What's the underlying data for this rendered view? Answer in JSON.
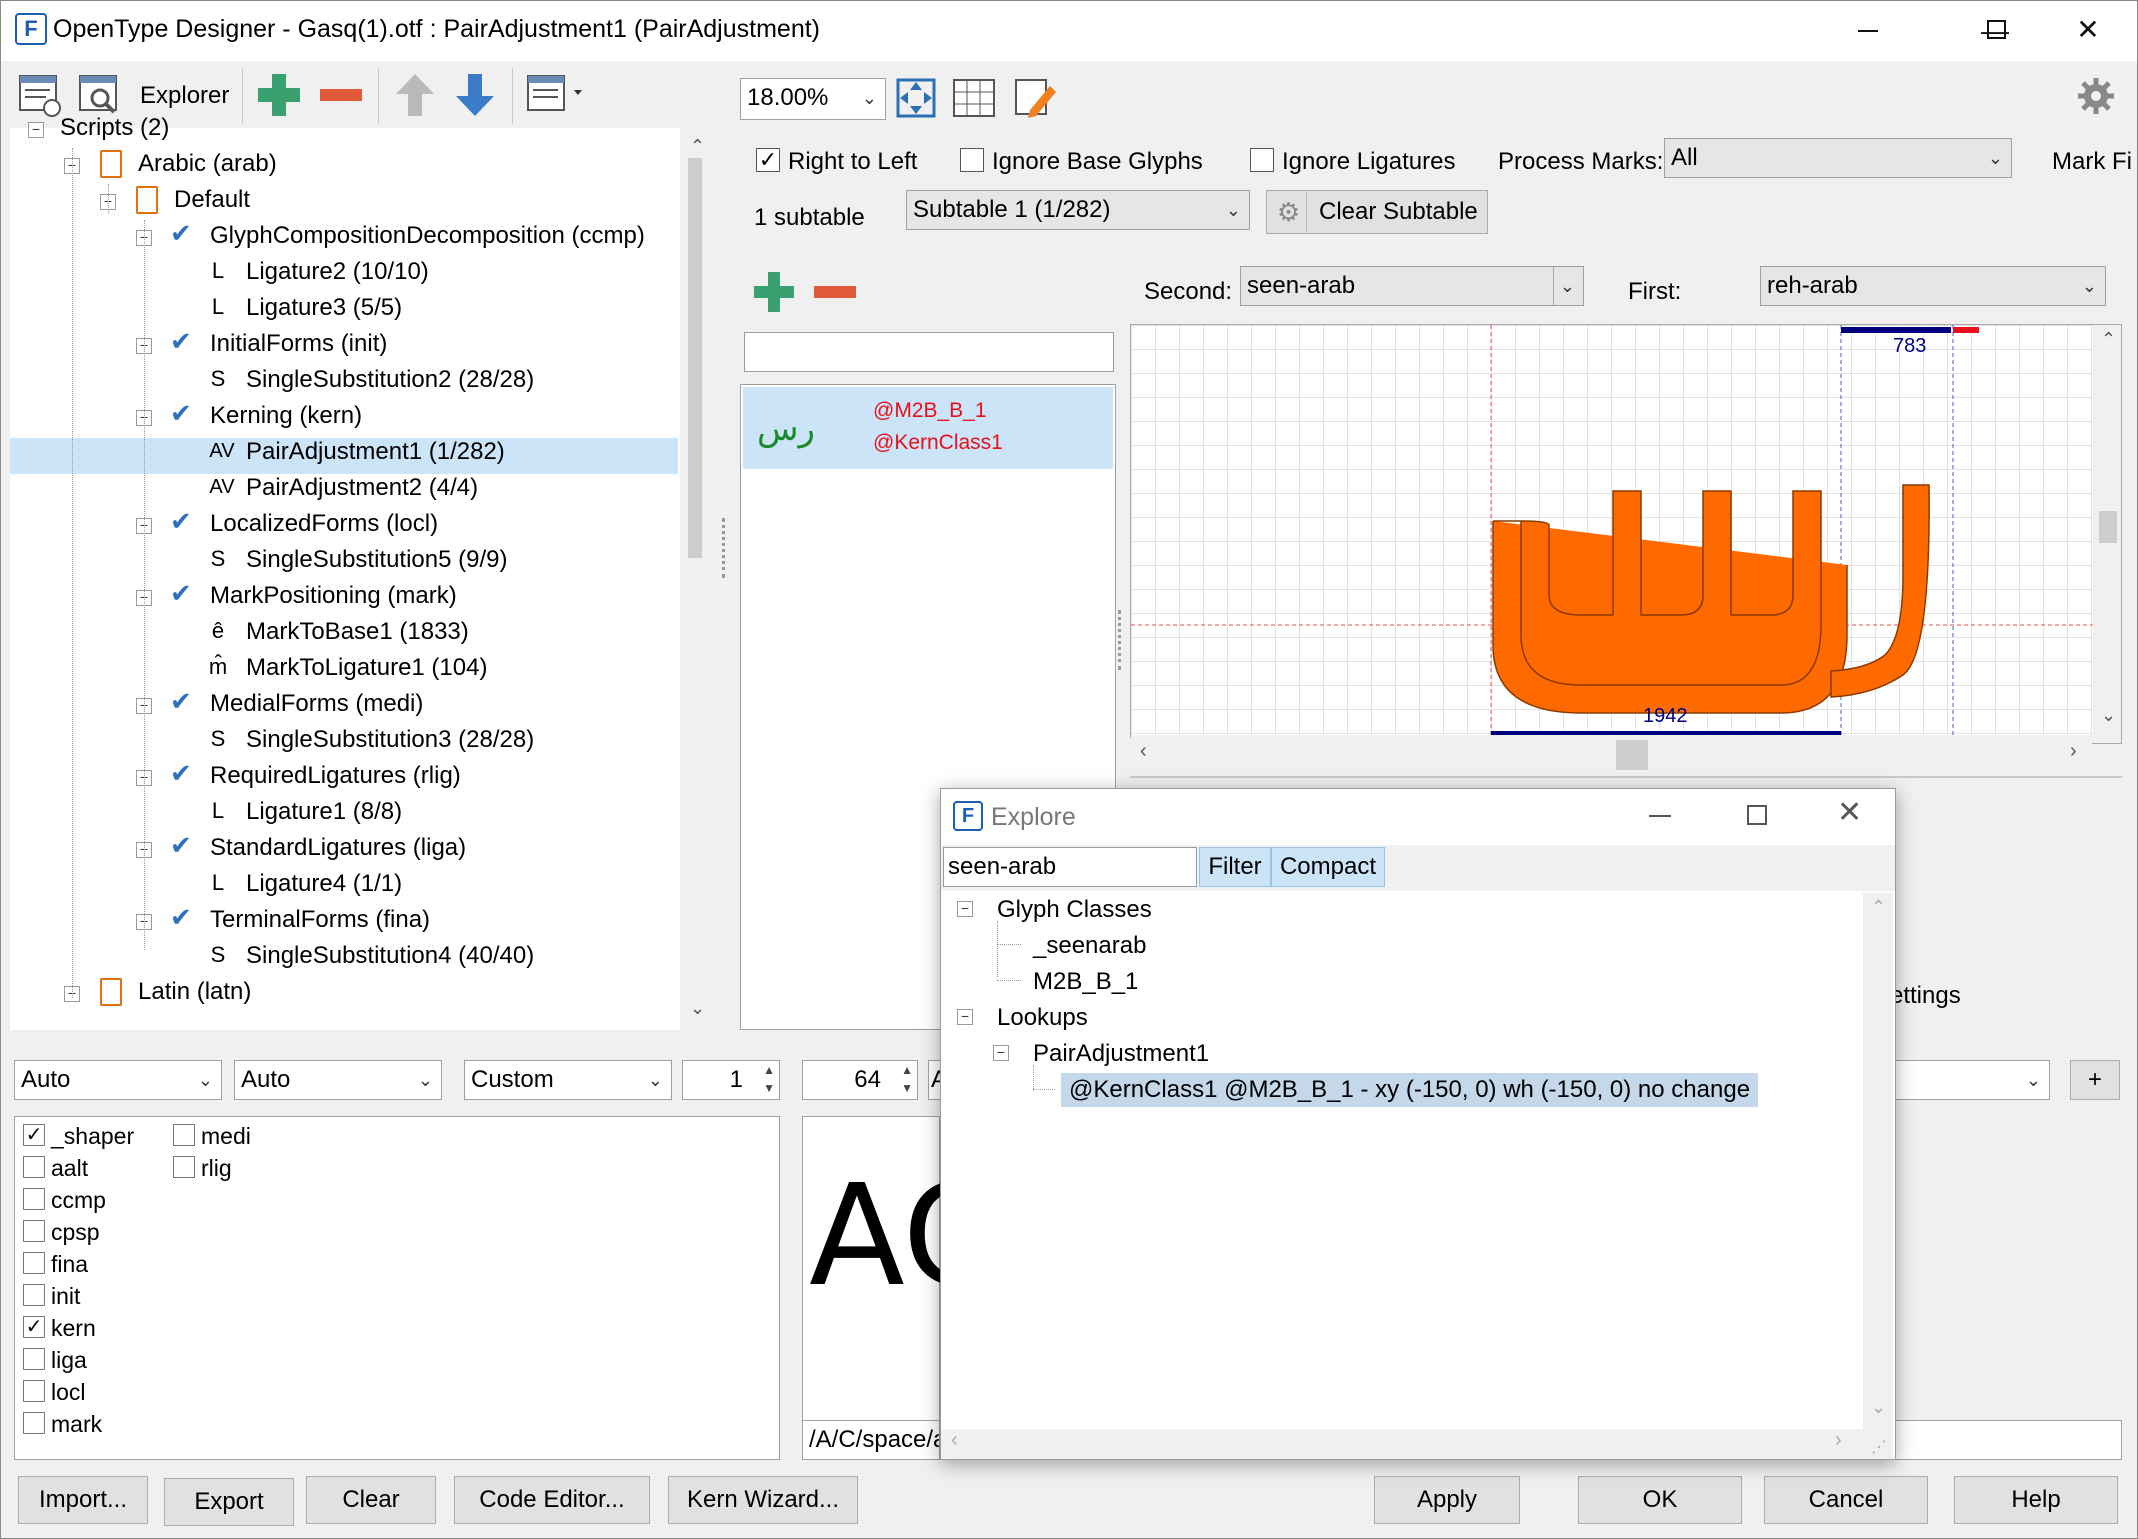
{
  "window": {
    "title": "OpenType Designer - Gasq(1).otf : PairAdjustment1 (PairAdjustment)",
    "app_icon": "F",
    "minimize": "—",
    "maximize": "☐",
    "close": "✕"
  },
  "toolbar": {
    "explorer_label": "Explorer",
    "zoom_value": "18.00%"
  },
  "tree": {
    "root": "Scripts (2)",
    "arabic": "Arabic (arab)",
    "default": "Default",
    "ccmp": "GlyphCompositionDecomposition (ccmp)",
    "lig2": "Ligature2 (10/10)",
    "lig3": "Ligature3 (5/5)",
    "init": "InitialForms (init)",
    "ss2": "SingleSubstitution2 (28/28)",
    "kern": "Kerning (kern)",
    "pa1": "PairAdjustment1 (1/282)",
    "pa2": "PairAdjustment2 (4/4)",
    "locl": "LocalizedForms (locl)",
    "ss5": "SingleSubstitution5 (9/9)",
    "mark": "MarkPositioning (mark)",
    "mtb": "MarkToBase1 (1833)",
    "mtl": "MarkToLigature1 (104)",
    "medi": "MedialForms (medi)",
    "ss3": "SingleSubstitution3 (28/28)",
    "rlig": "RequiredLigatures (rlig)",
    "lig1": "Ligature1 (8/8)",
    "liga": "StandardLigatures (liga)",
    "lig4": "Ligature4 (1/1)",
    "fina": "TerminalForms (fina)",
    "ss4": "SingleSubstitution4 (40/40)",
    "latin": "Latin (latn)",
    "icons": {
      "L": "L",
      "S": "S",
      "AV": "AV",
      "mtb": "ê",
      "mtl": "m̂"
    }
  },
  "options": {
    "rtl": "Right to Left",
    "ignore_base": "Ignore Base Glyphs",
    "ignore_lig": "Ignore Ligatures",
    "process_marks": "Process Marks:",
    "process_marks_value": "All",
    "mark_filter": "Mark Fi",
    "subtable_count": "1 subtable",
    "subtable_value": "Subtable 1 (1/282)",
    "clear_subtable": "Clear Subtable"
  },
  "pair": {
    "second_label": "Second:",
    "second_value": "seen-arab",
    "first_label": "First:",
    "first_value": "reh-arab",
    "list_glyph": "رس",
    "list_class1": "@M2B_B_1",
    "list_class2": "@KernClass1",
    "measure_top": "783",
    "measure_bottom": "1942",
    "settings_partial": "ettings"
  },
  "bottom": {
    "combo1": "Auto",
    "combo2": "Auto",
    "combo3": "Custom",
    "spin1": "1",
    "spin2": "64",
    "spin3_partial": "A",
    "preview_text": "AC",
    "preview_input": "/A/C/space/a",
    "plus": "+",
    "features": [
      {
        "name": "_shaper",
        "checked": true
      },
      {
        "name": "aalt",
        "checked": false
      },
      {
        "name": "ccmp",
        "checked": false
      },
      {
        "name": "cpsp",
        "checked": false
      },
      {
        "name": "fina",
        "checked": false
      },
      {
        "name": "init",
        "checked": false
      },
      {
        "name": "kern",
        "checked": true
      },
      {
        "name": "liga",
        "checked": false
      },
      {
        "name": "locl",
        "checked": false
      },
      {
        "name": "mark",
        "checked": false
      }
    ],
    "features2": [
      {
        "name": "medi",
        "checked": false
      },
      {
        "name": "rlig",
        "checked": false
      }
    ]
  },
  "buttons": {
    "import": "Import...",
    "export": "Export",
    "clear": "Clear",
    "code_editor": "Code Editor...",
    "kern_wizard": "Kern Wizard...",
    "apply": "Apply",
    "ok": "OK",
    "cancel": "Cancel",
    "help": "Help"
  },
  "explore": {
    "title": "Explore",
    "search_value": "seen-arab",
    "filter": "Filter",
    "compact": "Compact",
    "glyph_classes": "Glyph Classes",
    "gc1": "_seenarab",
    "gc2": "M2B_B_1",
    "lookups": "Lookups",
    "lookup1": "PairAdjustment1",
    "result": "@KernClass1 @M2B_B_1 - xy (-150, 0) wh (-150, 0) no change"
  },
  "colors": {
    "glyph_fill": "#ff6a00",
    "selection": "#cce4f7",
    "class_red": "#e8101a",
    "measure_blue": "#000080"
  }
}
